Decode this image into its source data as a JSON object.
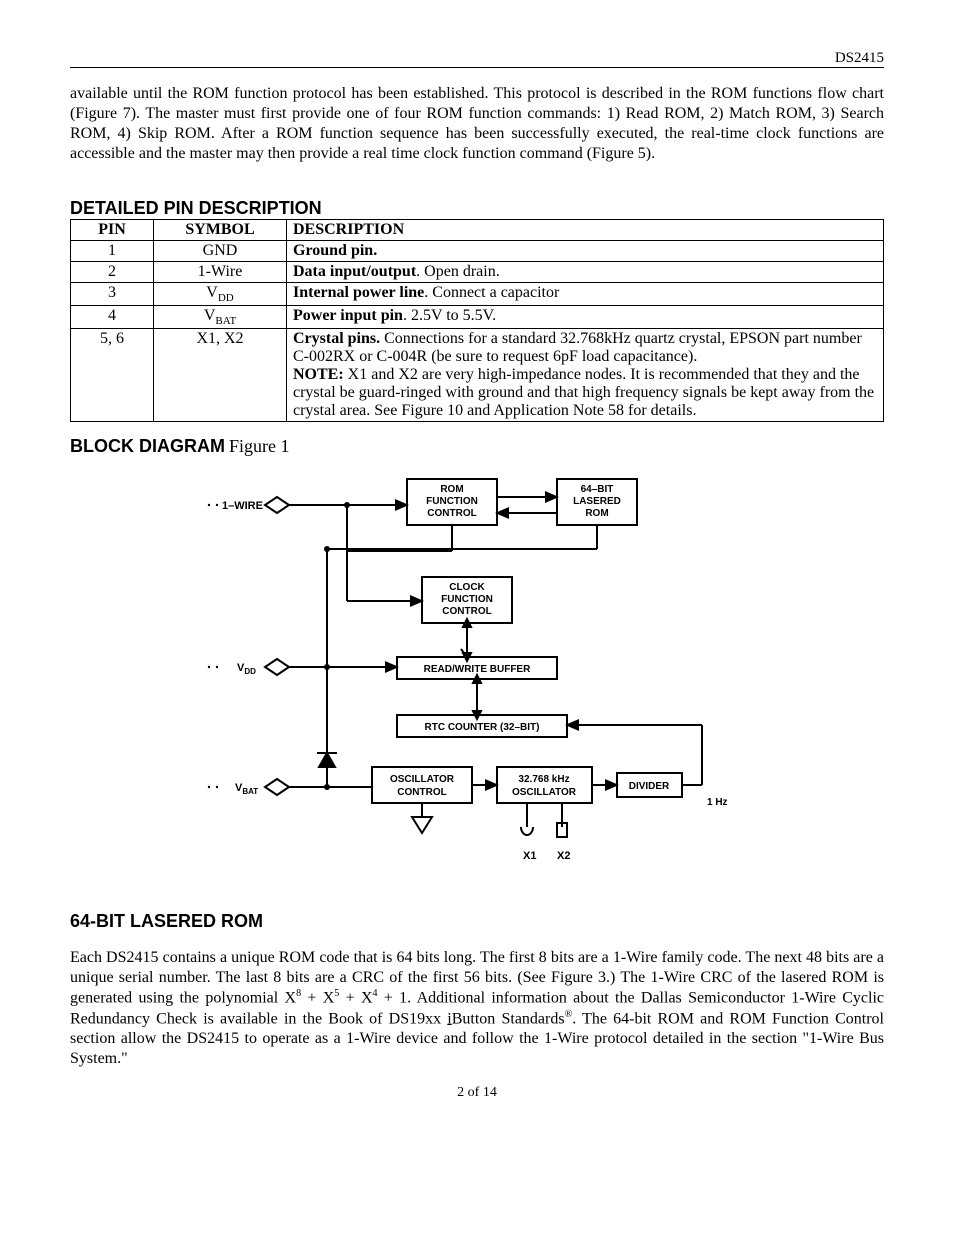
{
  "header": {
    "partNumber": "DS2415"
  },
  "intro": "available until the ROM function protocol has been established. This protocol is described in the ROM functions flow chart (Figure 7). The master must first provide one of four ROM function commands: 1) Read ROM, 2) Match ROM, 3) Search ROM, 4) Skip ROM. After a ROM function sequence has been successfully executed, the real-time clock functions are accessible and the master may then provide a real time clock function command (Figure 5).",
  "sections": {
    "pinDescTitle": "DETAILED PIN DESCRIPTION",
    "blockDiagramTitle": "BLOCK DIAGRAM",
    "blockDiagramFigure": "Figure 1",
    "romTitle": "64-BIT LASERED ROM"
  },
  "table": {
    "headers": {
      "pin": "PIN",
      "symbol": "SYMBOL",
      "description": "DESCRIPTION"
    },
    "rows": [
      {
        "pin": "1",
        "symbol": "GND",
        "descBold": "Ground pin.",
        "descRest": ""
      },
      {
        "pin": "2",
        "symbol": "1-Wire",
        "descBold": "Data input/output",
        "descRest": ". Open drain."
      },
      {
        "pin": "3",
        "symbolPrefix": "V",
        "symbolSub": "DD",
        "descBold": "Internal power line",
        "descRest": ". Connect a capacitor"
      },
      {
        "pin": "4",
        "symbolPrefix": "V",
        "symbolSub": "BAT",
        "descBold": "Power input pin",
        "descRest": ". 2.5V to 5.5V."
      },
      {
        "pin": "5, 6",
        "symbol": "X1, X2",
        "descBold": "Crystal pins.",
        "descRest": " Connections for a standard 32.768kHz quartz crystal, EPSON part number C-002RX or C-004R (be sure to request 6pF load capacitance).",
        "noteBold": "NOTE:",
        "noteRest": " X1 and X2 are very high-impedance nodes. It is recommended that they and the crystal be guard-ringed with ground and that high frequency signals be kept away from the crystal area. See Figure 10 and Application Note 58 for details."
      }
    ]
  },
  "diagram": {
    "pins": {
      "oneWire": "1–WIRE",
      "vdd": "VDD",
      "vbat": "VBAT",
      "x1": "X1",
      "x2": "X2"
    },
    "blocks": {
      "romFuncL1": "ROM",
      "romFuncL2": "FUNCTION",
      "romFuncL3": "CONTROL",
      "laseredRomL1": "64–BIT",
      "laseredRomL2": "LASERED",
      "laseredRomL3": "ROM",
      "clockFuncL1": "CLOCK",
      "clockFuncL2": "FUNCTION",
      "clockFuncL3": "CONTROL",
      "rwBuffer": "READ/WRITE BUFFER",
      "rtcCounter": "RTC COUNTER (32–BIT)",
      "oscCtrlL1": "OSCILLATOR",
      "oscCtrlL2": "CONTROL",
      "oscL1": "32.768 kHz",
      "oscL2": "OSCILLATOR",
      "divider": "DIVIDER",
      "oneHz": "1 Hz"
    }
  },
  "romText": {
    "p1a": "Each DS2415 contains a unique ROM code that is 64 bits long. The first 8 bits are a 1-Wire family code. The next 48 bits are a unique serial number. The last 8 bits are a CRC of the first 56 bits. (See Figure 3.) The 1-Wire CRC of the lasered ROM is generated using the polynomial X",
    "sup8": "8",
    "plus1": " + X",
    "sup5": "5",
    "plus2": " + X",
    "sup4": "4",
    "p1b": " + 1. Additional information about the Dallas Semiconductor 1-Wire Cyclic Redundancy Check is available in the Book of DS19xx ",
    "ibutton": "i",
    "ibuttonRest": "Button Standards",
    "reg": "®",
    "p1c": ". The 64-bit ROM and ROM Function Control section allow the DS2415 to operate as a 1-Wire device and follow the 1-Wire protocol detailed in the section \"1-Wire Bus System.\""
  },
  "pageNum": "2 of 14"
}
